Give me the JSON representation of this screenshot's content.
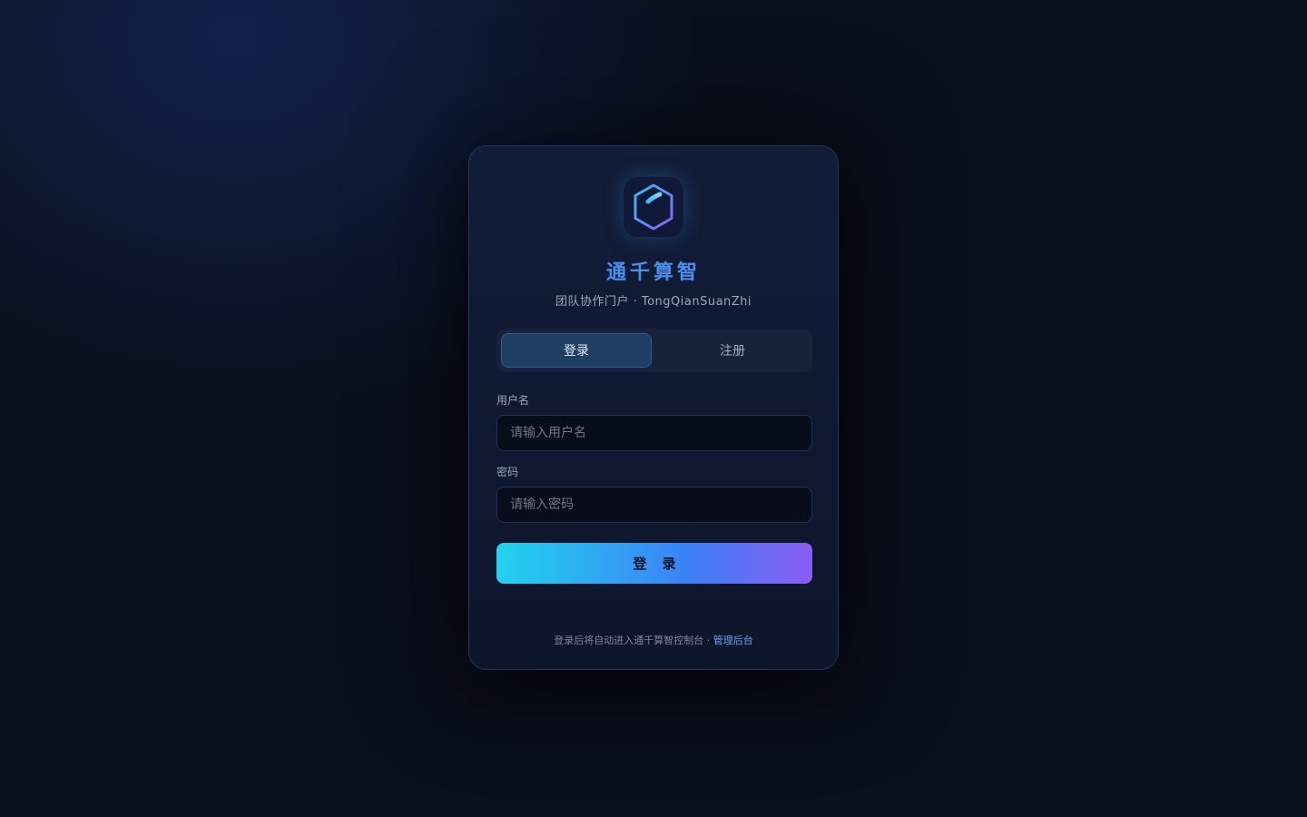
{
  "brand": {
    "logo_icon": "hexagon-qian-logo-icon",
    "title": "通千算智",
    "subtitle": "团队协作门户 · TongQianSuanZhi"
  },
  "tabs": [
    {
      "label": "登录",
      "active": true
    },
    {
      "label": "注册",
      "active": false
    }
  ],
  "form": {
    "username": {
      "label": "用户名",
      "placeholder": "请输入用户名",
      "value": ""
    },
    "password": {
      "label": "密码",
      "placeholder": "请输入密码",
      "value": ""
    },
    "submit_label": "登 录"
  },
  "footer": {
    "text": "登录后将自动进入通千算智控制台 · ",
    "link_label": "管理后台"
  },
  "colors": {
    "background": "#0a0f1c",
    "card": "#111b34",
    "accent_blue": "#4a8ff0",
    "gradient_start": "#22d3ee",
    "gradient_mid": "#3b82f6",
    "gradient_end": "#8b5cf6",
    "link": "#60a5fa"
  }
}
